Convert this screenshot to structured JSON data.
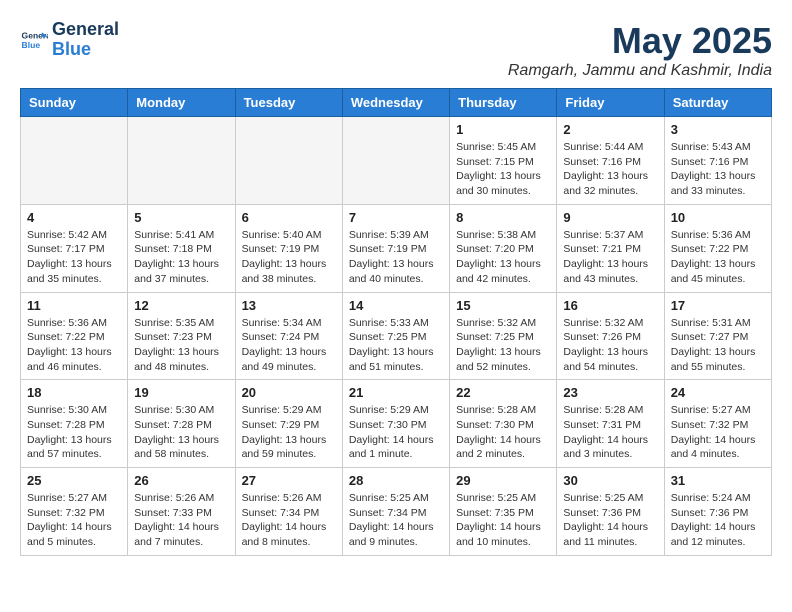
{
  "logo": {
    "line1": "General",
    "line2": "Blue"
  },
  "title": "May 2025",
  "subtitle": "Ramgarh, Jammu and Kashmir, India",
  "weekdays": [
    "Sunday",
    "Monday",
    "Tuesday",
    "Wednesday",
    "Thursday",
    "Friday",
    "Saturday"
  ],
  "weeks": [
    [
      {
        "day": "",
        "info": ""
      },
      {
        "day": "",
        "info": ""
      },
      {
        "day": "",
        "info": ""
      },
      {
        "day": "",
        "info": ""
      },
      {
        "day": "1",
        "info": "Sunrise: 5:45 AM\nSunset: 7:15 PM\nDaylight: 13 hours\nand 30 minutes."
      },
      {
        "day": "2",
        "info": "Sunrise: 5:44 AM\nSunset: 7:16 PM\nDaylight: 13 hours\nand 32 minutes."
      },
      {
        "day": "3",
        "info": "Sunrise: 5:43 AM\nSunset: 7:16 PM\nDaylight: 13 hours\nand 33 minutes."
      }
    ],
    [
      {
        "day": "4",
        "info": "Sunrise: 5:42 AM\nSunset: 7:17 PM\nDaylight: 13 hours\nand 35 minutes."
      },
      {
        "day": "5",
        "info": "Sunrise: 5:41 AM\nSunset: 7:18 PM\nDaylight: 13 hours\nand 37 minutes."
      },
      {
        "day": "6",
        "info": "Sunrise: 5:40 AM\nSunset: 7:19 PM\nDaylight: 13 hours\nand 38 minutes."
      },
      {
        "day": "7",
        "info": "Sunrise: 5:39 AM\nSunset: 7:19 PM\nDaylight: 13 hours\nand 40 minutes."
      },
      {
        "day": "8",
        "info": "Sunrise: 5:38 AM\nSunset: 7:20 PM\nDaylight: 13 hours\nand 42 minutes."
      },
      {
        "day": "9",
        "info": "Sunrise: 5:37 AM\nSunset: 7:21 PM\nDaylight: 13 hours\nand 43 minutes."
      },
      {
        "day": "10",
        "info": "Sunrise: 5:36 AM\nSunset: 7:22 PM\nDaylight: 13 hours\nand 45 minutes."
      }
    ],
    [
      {
        "day": "11",
        "info": "Sunrise: 5:36 AM\nSunset: 7:22 PM\nDaylight: 13 hours\nand 46 minutes."
      },
      {
        "day": "12",
        "info": "Sunrise: 5:35 AM\nSunset: 7:23 PM\nDaylight: 13 hours\nand 48 minutes."
      },
      {
        "day": "13",
        "info": "Sunrise: 5:34 AM\nSunset: 7:24 PM\nDaylight: 13 hours\nand 49 minutes."
      },
      {
        "day": "14",
        "info": "Sunrise: 5:33 AM\nSunset: 7:25 PM\nDaylight: 13 hours\nand 51 minutes."
      },
      {
        "day": "15",
        "info": "Sunrise: 5:32 AM\nSunset: 7:25 PM\nDaylight: 13 hours\nand 52 minutes."
      },
      {
        "day": "16",
        "info": "Sunrise: 5:32 AM\nSunset: 7:26 PM\nDaylight: 13 hours\nand 54 minutes."
      },
      {
        "day": "17",
        "info": "Sunrise: 5:31 AM\nSunset: 7:27 PM\nDaylight: 13 hours\nand 55 minutes."
      }
    ],
    [
      {
        "day": "18",
        "info": "Sunrise: 5:30 AM\nSunset: 7:28 PM\nDaylight: 13 hours\nand 57 minutes."
      },
      {
        "day": "19",
        "info": "Sunrise: 5:30 AM\nSunset: 7:28 PM\nDaylight: 13 hours\nand 58 minutes."
      },
      {
        "day": "20",
        "info": "Sunrise: 5:29 AM\nSunset: 7:29 PM\nDaylight: 13 hours\nand 59 minutes."
      },
      {
        "day": "21",
        "info": "Sunrise: 5:29 AM\nSunset: 7:30 PM\nDaylight: 14 hours\nand 1 minute."
      },
      {
        "day": "22",
        "info": "Sunrise: 5:28 AM\nSunset: 7:30 PM\nDaylight: 14 hours\nand 2 minutes."
      },
      {
        "day": "23",
        "info": "Sunrise: 5:28 AM\nSunset: 7:31 PM\nDaylight: 14 hours\nand 3 minutes."
      },
      {
        "day": "24",
        "info": "Sunrise: 5:27 AM\nSunset: 7:32 PM\nDaylight: 14 hours\nand 4 minutes."
      }
    ],
    [
      {
        "day": "25",
        "info": "Sunrise: 5:27 AM\nSunset: 7:32 PM\nDaylight: 14 hours\nand 5 minutes."
      },
      {
        "day": "26",
        "info": "Sunrise: 5:26 AM\nSunset: 7:33 PM\nDaylight: 14 hours\nand 7 minutes."
      },
      {
        "day": "27",
        "info": "Sunrise: 5:26 AM\nSunset: 7:34 PM\nDaylight: 14 hours\nand 8 minutes."
      },
      {
        "day": "28",
        "info": "Sunrise: 5:25 AM\nSunset: 7:34 PM\nDaylight: 14 hours\nand 9 minutes."
      },
      {
        "day": "29",
        "info": "Sunrise: 5:25 AM\nSunset: 7:35 PM\nDaylight: 14 hours\nand 10 minutes."
      },
      {
        "day": "30",
        "info": "Sunrise: 5:25 AM\nSunset: 7:36 PM\nDaylight: 14 hours\nand 11 minutes."
      },
      {
        "day": "31",
        "info": "Sunrise: 5:24 AM\nSunset: 7:36 PM\nDaylight: 14 hours\nand 12 minutes."
      }
    ]
  ]
}
